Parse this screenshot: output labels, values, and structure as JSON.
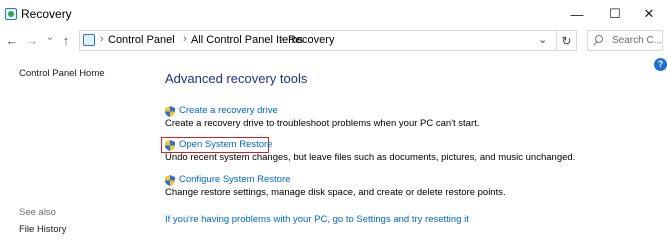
{
  "window": {
    "title": "Recovery"
  },
  "window_controls": {
    "minimize": "—",
    "maximize": "☐",
    "close": "✕"
  },
  "nav": {
    "back": "←",
    "forward": "→",
    "recent": "⌄",
    "up": "↑"
  },
  "address": {
    "crumbs": [
      "Control Panel",
      "All Control Panel Items",
      "Recovery"
    ],
    "separator": "›",
    "dropdown": "⌄",
    "refresh": "↻"
  },
  "search": {
    "placeholder": "Search C..."
  },
  "help": {
    "label": "?"
  },
  "sidebar": {
    "home_label": "Control Panel Home",
    "see_also_label": "See also",
    "see_also_items": [
      "File History"
    ]
  },
  "main": {
    "heading": "Advanced recovery tools",
    "tasks": [
      {
        "link": "Create a recovery drive",
        "description": "Create a recovery drive to troubleshoot problems when your PC can't start.",
        "highlighted": false
      },
      {
        "link": "Open System Restore",
        "description": "Undo recent system changes, but leave files such as documents, pictures, and music unchanged.",
        "highlighted": true
      },
      {
        "link": "Configure System Restore",
        "description": "Change restore settings, manage disk space, and create or delete restore points.",
        "highlighted": false
      }
    ],
    "reset_link": "If you're having problems with your PC, go to Settings and try resetting it"
  },
  "colors": {
    "link": "#0066cc",
    "heading": "#1e3287",
    "highlight": "#d42020",
    "help": "#1e6fd0"
  }
}
